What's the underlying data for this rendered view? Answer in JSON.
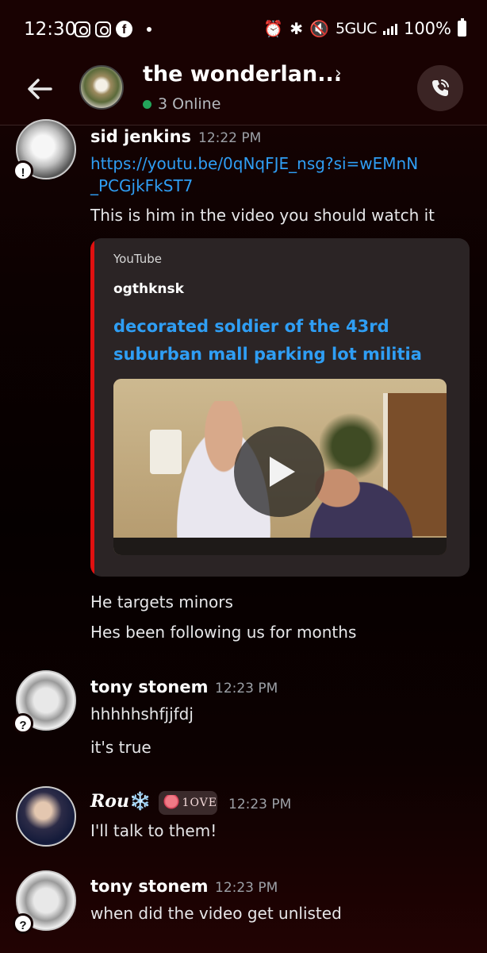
{
  "status_bar": {
    "time": "12:30",
    "network": "5GUC",
    "battery": "100%"
  },
  "header": {
    "title": "the wonderlan...",
    "online_text": "3 Online",
    "icons": [
      "back-arrow-icon",
      "chevron-right-icon",
      "phone-call-icon"
    ]
  },
  "messages": [
    {
      "author": "sid jenkins",
      "time": "12:22 PM",
      "link": "https://youtu.be/0qNqFJE_nsg?si=wEMnN_PCGjkFkST7",
      "link_line1": "https://youtu.be/0qNqFJE_nsg?si=wEMnN",
      "link_line2": "_PCGjkFkST7",
      "text": "This is him in the video you should watch it",
      "badge": "!",
      "embed": {
        "provider": "YouTube",
        "author": "ogthknsk",
        "title": "decorated soldier of the 43rd suburban mall parking lot militia"
      },
      "followups": [
        "He targets minors",
        "Hes been following us for months"
      ]
    },
    {
      "author": "tony stonem",
      "time": "12:23 PM",
      "badge": "?",
      "text": "hhhhhshfjjfdj",
      "followups": [
        "it's true"
      ]
    },
    {
      "author": "Rou",
      "author_suffix": "❄️",
      "role_tag": "1OVE",
      "time": "12:23 PM",
      "text": "I'll talk to them!"
    },
    {
      "author": "tony stonem",
      "time": "12:23 PM",
      "badge": "?",
      "text": "when did the video get unlisted"
    }
  ],
  "colors": {
    "link": "#2f9ef4",
    "embed_accent": "#e01010",
    "online": "#23a55a"
  }
}
